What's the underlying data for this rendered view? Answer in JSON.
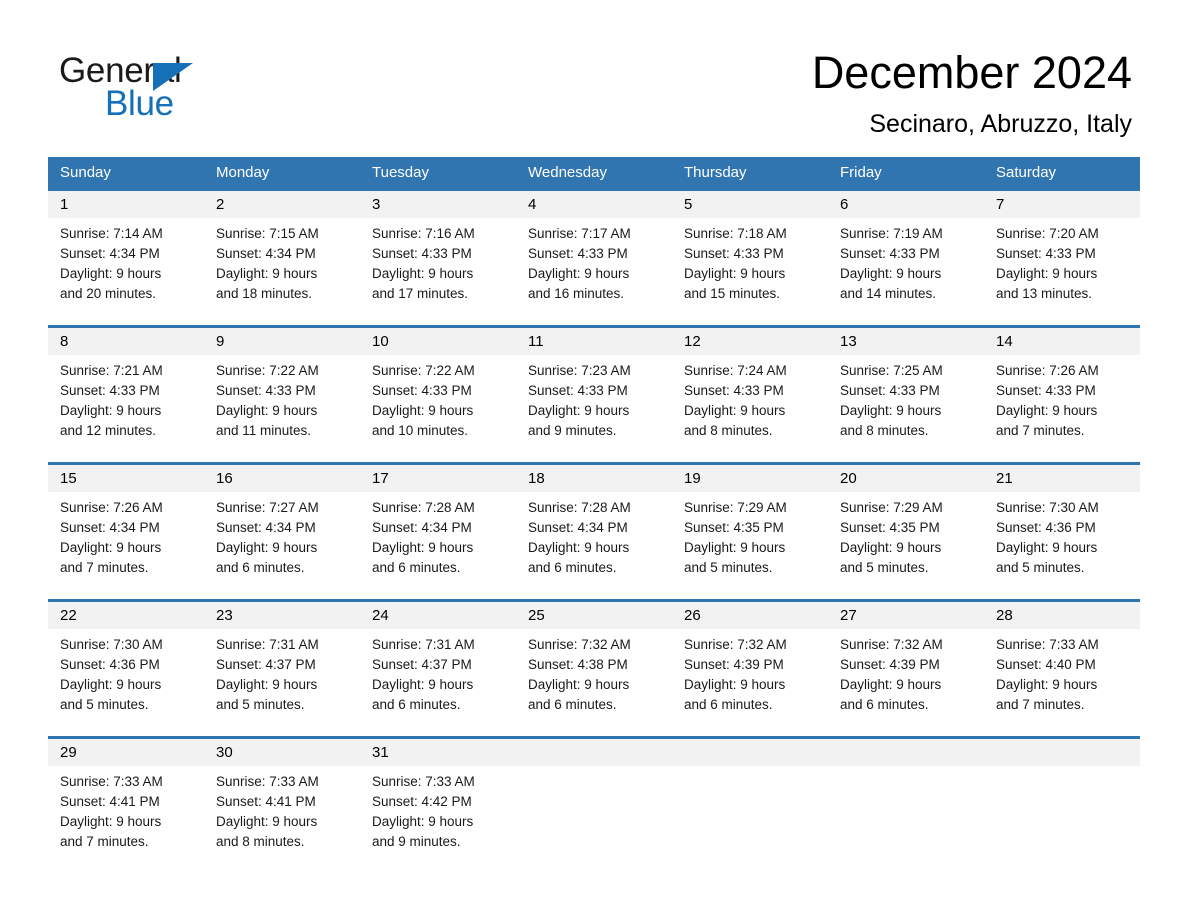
{
  "brand": {
    "name_part1": "General",
    "name_part2": "Blue"
  },
  "header": {
    "month_title": "December 2024",
    "location": "Secinaro, Abruzzo, Italy"
  },
  "colors": {
    "header_blue": "#3175b0",
    "brand_blue": "#1570b8",
    "daynum_band": "#f2f2f2"
  },
  "weekday_headers": [
    "Sunday",
    "Monday",
    "Tuesday",
    "Wednesday",
    "Thursday",
    "Friday",
    "Saturday"
  ],
  "weeks": [
    {
      "days": [
        {
          "num": "1",
          "sunrise": "Sunrise: 7:14 AM",
          "sunset": "Sunset: 4:34 PM",
          "daylight_line1": "Daylight: 9 hours",
          "daylight_line2": "and 20 minutes."
        },
        {
          "num": "2",
          "sunrise": "Sunrise: 7:15 AM",
          "sunset": "Sunset: 4:34 PM",
          "daylight_line1": "Daylight: 9 hours",
          "daylight_line2": "and 18 minutes."
        },
        {
          "num": "3",
          "sunrise": "Sunrise: 7:16 AM",
          "sunset": "Sunset: 4:33 PM",
          "daylight_line1": "Daylight: 9 hours",
          "daylight_line2": "and 17 minutes."
        },
        {
          "num": "4",
          "sunrise": "Sunrise: 7:17 AM",
          "sunset": "Sunset: 4:33 PM",
          "daylight_line1": "Daylight: 9 hours",
          "daylight_line2": "and 16 minutes."
        },
        {
          "num": "5",
          "sunrise": "Sunrise: 7:18 AM",
          "sunset": "Sunset: 4:33 PM",
          "daylight_line1": "Daylight: 9 hours",
          "daylight_line2": "and 15 minutes."
        },
        {
          "num": "6",
          "sunrise": "Sunrise: 7:19 AM",
          "sunset": "Sunset: 4:33 PM",
          "daylight_line1": "Daylight: 9 hours",
          "daylight_line2": "and 14 minutes."
        },
        {
          "num": "7",
          "sunrise": "Sunrise: 7:20 AM",
          "sunset": "Sunset: 4:33 PM",
          "daylight_line1": "Daylight: 9 hours",
          "daylight_line2": "and 13 minutes."
        }
      ]
    },
    {
      "days": [
        {
          "num": "8",
          "sunrise": "Sunrise: 7:21 AM",
          "sunset": "Sunset: 4:33 PM",
          "daylight_line1": "Daylight: 9 hours",
          "daylight_line2": "and 12 minutes."
        },
        {
          "num": "9",
          "sunrise": "Sunrise: 7:22 AM",
          "sunset": "Sunset: 4:33 PM",
          "daylight_line1": "Daylight: 9 hours",
          "daylight_line2": "and 11 minutes."
        },
        {
          "num": "10",
          "sunrise": "Sunrise: 7:22 AM",
          "sunset": "Sunset: 4:33 PM",
          "daylight_line1": "Daylight: 9 hours",
          "daylight_line2": "and 10 minutes."
        },
        {
          "num": "11",
          "sunrise": "Sunrise: 7:23 AM",
          "sunset": "Sunset: 4:33 PM",
          "daylight_line1": "Daylight: 9 hours",
          "daylight_line2": "and 9 minutes."
        },
        {
          "num": "12",
          "sunrise": "Sunrise: 7:24 AM",
          "sunset": "Sunset: 4:33 PM",
          "daylight_line1": "Daylight: 9 hours",
          "daylight_line2": "and 8 minutes."
        },
        {
          "num": "13",
          "sunrise": "Sunrise: 7:25 AM",
          "sunset": "Sunset: 4:33 PM",
          "daylight_line1": "Daylight: 9 hours",
          "daylight_line2": "and 8 minutes."
        },
        {
          "num": "14",
          "sunrise": "Sunrise: 7:26 AM",
          "sunset": "Sunset: 4:33 PM",
          "daylight_line1": "Daylight: 9 hours",
          "daylight_line2": "and 7 minutes."
        }
      ]
    },
    {
      "days": [
        {
          "num": "15",
          "sunrise": "Sunrise: 7:26 AM",
          "sunset": "Sunset: 4:34 PM",
          "daylight_line1": "Daylight: 9 hours",
          "daylight_line2": "and 7 minutes."
        },
        {
          "num": "16",
          "sunrise": "Sunrise: 7:27 AM",
          "sunset": "Sunset: 4:34 PM",
          "daylight_line1": "Daylight: 9 hours",
          "daylight_line2": "and 6 minutes."
        },
        {
          "num": "17",
          "sunrise": "Sunrise: 7:28 AM",
          "sunset": "Sunset: 4:34 PM",
          "daylight_line1": "Daylight: 9 hours",
          "daylight_line2": "and 6 minutes."
        },
        {
          "num": "18",
          "sunrise": "Sunrise: 7:28 AM",
          "sunset": "Sunset: 4:34 PM",
          "daylight_line1": "Daylight: 9 hours",
          "daylight_line2": "and 6 minutes."
        },
        {
          "num": "19",
          "sunrise": "Sunrise: 7:29 AM",
          "sunset": "Sunset: 4:35 PM",
          "daylight_line1": "Daylight: 9 hours",
          "daylight_line2": "and 5 minutes."
        },
        {
          "num": "20",
          "sunrise": "Sunrise: 7:29 AM",
          "sunset": "Sunset: 4:35 PM",
          "daylight_line1": "Daylight: 9 hours",
          "daylight_line2": "and 5 minutes."
        },
        {
          "num": "21",
          "sunrise": "Sunrise: 7:30 AM",
          "sunset": "Sunset: 4:36 PM",
          "daylight_line1": "Daylight: 9 hours",
          "daylight_line2": "and 5 minutes."
        }
      ]
    },
    {
      "days": [
        {
          "num": "22",
          "sunrise": "Sunrise: 7:30 AM",
          "sunset": "Sunset: 4:36 PM",
          "daylight_line1": "Daylight: 9 hours",
          "daylight_line2": "and 5 minutes."
        },
        {
          "num": "23",
          "sunrise": "Sunrise: 7:31 AM",
          "sunset": "Sunset: 4:37 PM",
          "daylight_line1": "Daylight: 9 hours",
          "daylight_line2": "and 5 minutes."
        },
        {
          "num": "24",
          "sunrise": "Sunrise: 7:31 AM",
          "sunset": "Sunset: 4:37 PM",
          "daylight_line1": "Daylight: 9 hours",
          "daylight_line2": "and 6 minutes."
        },
        {
          "num": "25",
          "sunrise": "Sunrise: 7:32 AM",
          "sunset": "Sunset: 4:38 PM",
          "daylight_line1": "Daylight: 9 hours",
          "daylight_line2": "and 6 minutes."
        },
        {
          "num": "26",
          "sunrise": "Sunrise: 7:32 AM",
          "sunset": "Sunset: 4:39 PM",
          "daylight_line1": "Daylight: 9 hours",
          "daylight_line2": "and 6 minutes."
        },
        {
          "num": "27",
          "sunrise": "Sunrise: 7:32 AM",
          "sunset": "Sunset: 4:39 PM",
          "daylight_line1": "Daylight: 9 hours",
          "daylight_line2": "and 6 minutes."
        },
        {
          "num": "28",
          "sunrise": "Sunrise: 7:33 AM",
          "sunset": "Sunset: 4:40 PM",
          "daylight_line1": "Daylight: 9 hours",
          "daylight_line2": "and 7 minutes."
        }
      ]
    },
    {
      "days": [
        {
          "num": "29",
          "sunrise": "Sunrise: 7:33 AM",
          "sunset": "Sunset: 4:41 PM",
          "daylight_line1": "Daylight: 9 hours",
          "daylight_line2": "and 7 minutes."
        },
        {
          "num": "30",
          "sunrise": "Sunrise: 7:33 AM",
          "sunset": "Sunset: 4:41 PM",
          "daylight_line1": "Daylight: 9 hours",
          "daylight_line2": "and 8 minutes."
        },
        {
          "num": "31",
          "sunrise": "Sunrise: 7:33 AM",
          "sunset": "Sunset: 4:42 PM",
          "daylight_line1": "Daylight: 9 hours",
          "daylight_line2": "and 9 minutes."
        },
        {
          "num": "",
          "sunrise": "",
          "sunset": "",
          "daylight_line1": "",
          "daylight_line2": ""
        },
        {
          "num": "",
          "sunrise": "",
          "sunset": "",
          "daylight_line1": "",
          "daylight_line2": ""
        },
        {
          "num": "",
          "sunrise": "",
          "sunset": "",
          "daylight_line1": "",
          "daylight_line2": ""
        },
        {
          "num": "",
          "sunrise": "",
          "sunset": "",
          "daylight_line1": "",
          "daylight_line2": ""
        }
      ]
    }
  ]
}
